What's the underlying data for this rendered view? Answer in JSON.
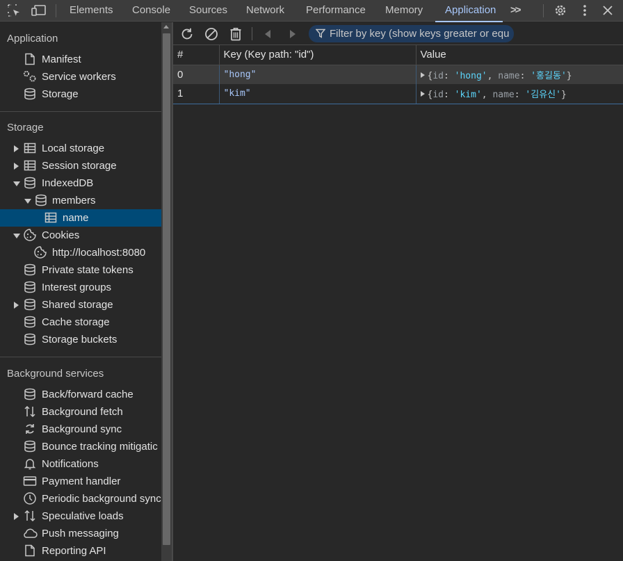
{
  "topbar": {
    "tabs": [
      "Elements",
      "Console",
      "Sources",
      "Network",
      "Performance",
      "Memory",
      "Application"
    ],
    "active_tab": "Application",
    "more_label": ">>"
  },
  "sidebar": {
    "application": {
      "title": "Application",
      "items": [
        {
          "label": "Manifest",
          "icon": "document-icon"
        },
        {
          "label": "Service workers",
          "icon": "gears-icon"
        },
        {
          "label": "Storage",
          "icon": "database-icon"
        }
      ]
    },
    "storage": {
      "title": "Storage",
      "items": [
        {
          "label": "Local storage",
          "icon": "table-icon",
          "expander": "collapsed"
        },
        {
          "label": "Session storage",
          "icon": "table-icon",
          "expander": "collapsed"
        },
        {
          "label": "IndexedDB",
          "icon": "database-icon",
          "expander": "expanded"
        },
        {
          "label": "members",
          "icon": "database-icon",
          "expander": "expanded"
        },
        {
          "label": "name",
          "icon": "table-icon",
          "selected": true
        },
        {
          "label": "Cookies",
          "icon": "cookie-icon",
          "expander": "expanded"
        },
        {
          "label": "http://localhost:8080",
          "icon": "cookie-icon"
        },
        {
          "label": "Private state tokens",
          "icon": "database-icon"
        },
        {
          "label": "Interest groups",
          "icon": "database-icon"
        },
        {
          "label": "Shared storage",
          "icon": "database-icon",
          "expander": "collapsed"
        },
        {
          "label": "Cache storage",
          "icon": "database-icon"
        },
        {
          "label": "Storage buckets",
          "icon": "database-icon"
        }
      ]
    },
    "background": {
      "title": "Background services",
      "items": [
        {
          "label": "Back/forward cache",
          "icon": "database-icon"
        },
        {
          "label": "Background fetch",
          "icon": "up-down-arrows-icon"
        },
        {
          "label": "Background sync",
          "icon": "sync-icon"
        },
        {
          "label": "Bounce tracking mitigatic",
          "icon": "database-icon"
        },
        {
          "label": "Notifications",
          "icon": "bell-icon"
        },
        {
          "label": "Payment handler",
          "icon": "card-icon"
        },
        {
          "label": "Periodic background sync",
          "icon": "clock-icon"
        },
        {
          "label": "Speculative loads",
          "icon": "up-down-arrows-icon",
          "expander": "collapsed"
        },
        {
          "label": "Push messaging",
          "icon": "cloud-icon"
        },
        {
          "label": "Reporting API",
          "icon": "document-icon"
        }
      ]
    }
  },
  "main": {
    "filter_placeholder": "Filter by key (show keys greater or equ",
    "columns": [
      "#",
      "Key (Key path: \"id\")",
      "Value"
    ],
    "rows": [
      {
        "index": "0",
        "key": "\"hong\"",
        "value": {
          "id_key": "id",
          "id": "'hong'",
          "name_key": "name",
          "name": "'홍길동'"
        }
      },
      {
        "index": "1",
        "key": "\"kim\"",
        "value": {
          "id_key": "id",
          "id": "'kim'",
          "name_key": "name",
          "name": "'김유신'"
        }
      }
    ]
  }
}
